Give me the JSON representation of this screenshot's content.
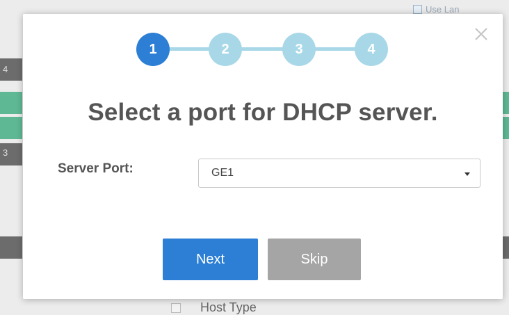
{
  "wizard": {
    "steps": [
      "1",
      "2",
      "3",
      "4"
    ],
    "active_step": 1,
    "title": "Select a port for DHCP server.",
    "server_port": {
      "label": "Server Port:",
      "value": "GE1"
    },
    "buttons": {
      "next": "Next",
      "skip": "Skip"
    }
  },
  "background": {
    "bottom_text": "Host Type",
    "top_right_text": "Use Lan",
    "left_numbers": [
      "4",
      "3"
    ]
  },
  "colors": {
    "accent": "#2c7fd4",
    "step_inactive": "#a8d8e8",
    "skip_button": "#a5a5a5",
    "title_text": "#555555"
  }
}
